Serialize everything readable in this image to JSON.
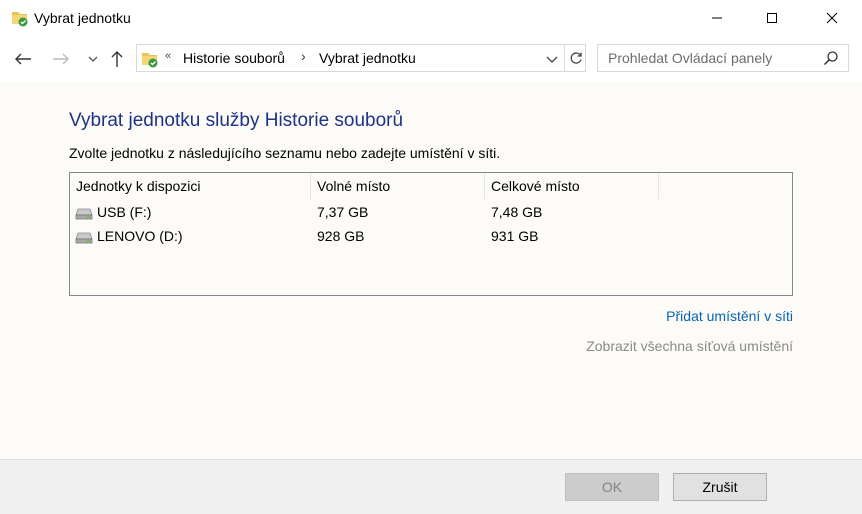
{
  "window": {
    "title": "Vybrat jednotku"
  },
  "navigation": {
    "breadcrumb_overflow": "«",
    "crumbs": [
      "Historie souborů",
      "Vybrat jednotku"
    ],
    "separator": "›"
  },
  "search": {
    "placeholder": "Prohledat Ovládací panely"
  },
  "main": {
    "heading": "Vybrat jednotku služby Historie souborů",
    "instructions": "Zvolte jednotku z následujícího seznamu nebo zadejte umístění v síti."
  },
  "drive_list": {
    "columns": [
      "Jednotky k dispozici",
      "Volné místo",
      "Celkové místo"
    ],
    "rows": [
      {
        "name": "USB (F:)",
        "free": "7,37 GB",
        "total": "7,48 GB",
        "icon": "drive-icon"
      },
      {
        "name": "LENOVO (D:)",
        "free": "928 GB",
        "total": "931 GB",
        "icon": "drive-icon"
      }
    ]
  },
  "links": {
    "add_network": "Přidat umístění v síti",
    "show_all_network": "Zobrazit všechna síťová umístění"
  },
  "footer": {
    "ok_label": "OK",
    "cancel_label": "Zrušit"
  },
  "colors": {
    "heading": "#1e3287",
    "link": "#0a62b5",
    "disabled_link": "#8a8a8a",
    "background": "#fcfbf8"
  }
}
